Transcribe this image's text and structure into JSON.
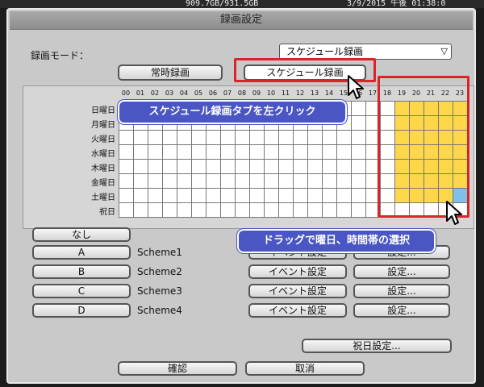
{
  "status": {
    "disk": "909.7GB/931.5GB",
    "datetime": "3/9/2015 午後 01:38:0"
  },
  "window": {
    "title": "録画設定"
  },
  "mode": {
    "label": "録画モード：",
    "selected": "スケジュール録画"
  },
  "tabs": [
    {
      "label": "常時録画",
      "active": false
    },
    {
      "label": "スケジュール録画",
      "active": true
    }
  ],
  "hours": [
    "00",
    "01",
    "02",
    "03",
    "04",
    "05",
    "06",
    "07",
    "08",
    "09",
    "10",
    "11",
    "12",
    "13",
    "14",
    "15",
    "16",
    "17",
    "18",
    "19",
    "20",
    "21",
    "22",
    "23"
  ],
  "days": [
    "日曜日",
    "月曜日",
    "火曜日",
    "水曜日",
    "木曜日",
    "金曜日",
    "土曜日",
    "祝日"
  ],
  "selection": {
    "hour_from": 19,
    "hour_to": 23,
    "day_from": 0,
    "day_to": 6
  },
  "schemes": {
    "none_label": "なし",
    "items": [
      {
        "button": "A",
        "name": "Scheme1",
        "event": "イベント設定",
        "setting": "設定..."
      },
      {
        "button": "B",
        "name": "Scheme2",
        "event": "イベント設定",
        "setting": "設定..."
      },
      {
        "button": "C",
        "name": "Scheme3",
        "event": "イベント設定",
        "setting": "設定..."
      },
      {
        "button": "D",
        "name": "Scheme4",
        "event": "イベント設定",
        "setting": "設定..."
      }
    ]
  },
  "holiday_button": "祝日設定...",
  "footer": {
    "ok": "確認",
    "cancel": "取消"
  },
  "annotations": {
    "tab_hint": "スケジュール録画タブを左クリック",
    "drag_hint": "ドラッグで曜日、時間帯の選択",
    "accent": "#d9252a",
    "callout_color": "#4a56c4",
    "selection_color": "#fcd74a"
  }
}
